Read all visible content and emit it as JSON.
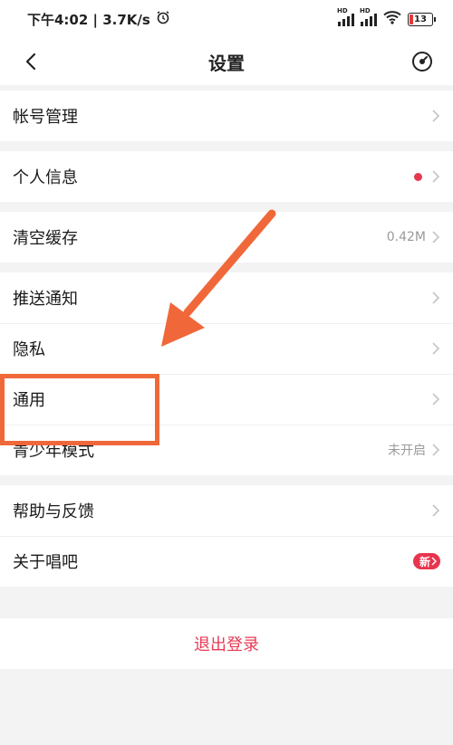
{
  "status_bar": {
    "time_speed": "下午4:02 | 3.7K/s",
    "sim1_label": "HD",
    "sim2_label": "HD",
    "battery": "13"
  },
  "header": {
    "title": "设置"
  },
  "groups": [
    {
      "items": [
        {
          "label": "帐号管理"
        }
      ]
    },
    {
      "items": [
        {
          "label": "个人信息"
        }
      ]
    },
    {
      "items": [
        {
          "label": "清空缓存",
          "value": "0.42M"
        }
      ]
    },
    {
      "items": [
        {
          "label": "推送通知"
        },
        {
          "label": "隐私"
        },
        {
          "label": "通用"
        },
        {
          "label": "青少年模式",
          "value": "未开启"
        }
      ]
    },
    {
      "items": [
        {
          "label": "帮助与反馈"
        },
        {
          "label": "关于唱吧",
          "badge": "新"
        }
      ]
    }
  ],
  "logout": {
    "label": "退出登录"
  },
  "colors": {
    "accent": "#e83a55",
    "annotation": "#f0683a"
  }
}
